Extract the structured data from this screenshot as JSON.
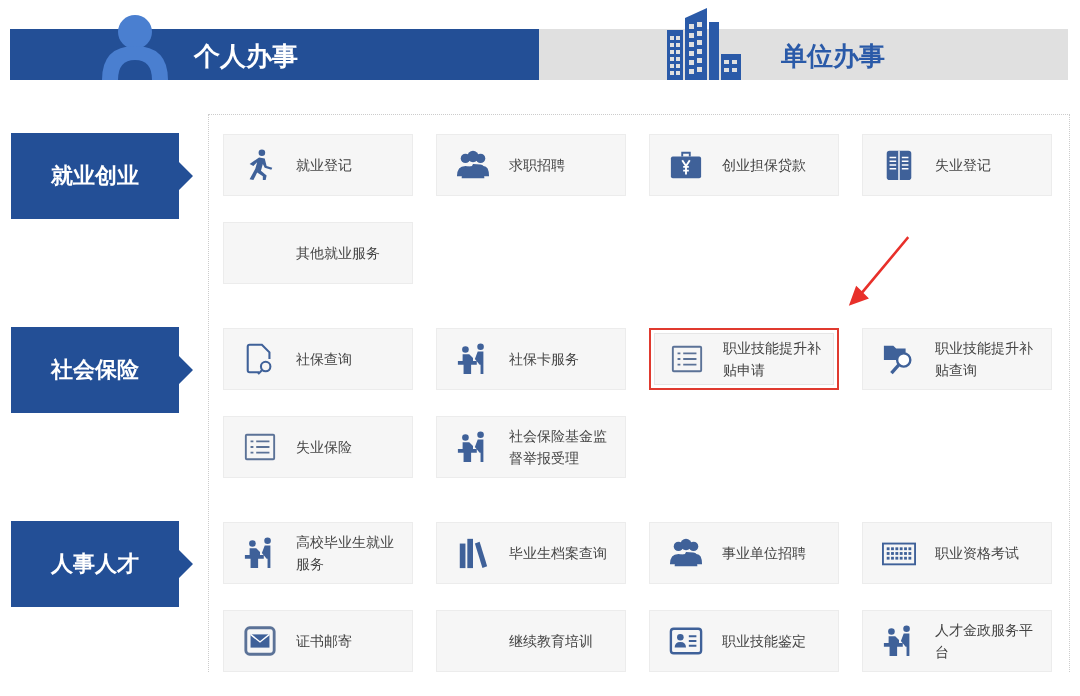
{
  "tabs": [
    {
      "label": "个人办事",
      "selected": true,
      "kind": "person"
    },
    {
      "label": "单位办事",
      "selected": false,
      "kind": "building"
    }
  ],
  "groups": [
    {
      "label": "就业创业",
      "items": [
        {
          "label": "就业登记",
          "kind": "walk",
          "highlighted": false
        },
        {
          "label": "求职招聘",
          "kind": "people",
          "highlighted": false
        },
        {
          "label": "创业担保贷款",
          "kind": "case",
          "highlighted": false
        },
        {
          "label": "失业登记",
          "kind": "book",
          "highlighted": false
        },
        {
          "label": "其他就业服务",
          "kind": "none",
          "highlighted": false
        }
      ]
    },
    {
      "label": "社会保险",
      "items": [
        {
          "label": "社保查询",
          "kind": "docsearch",
          "highlighted": false
        },
        {
          "label": "社保卡服务",
          "kind": "service",
          "highlighted": false
        },
        {
          "label": "职业技能提升补贴申请",
          "kind": "list",
          "highlighted": true
        },
        {
          "label": "职业技能提升补贴查询",
          "kind": "foldersearch",
          "highlighted": false
        },
        {
          "label": "失业保险",
          "kind": "lines",
          "highlighted": false
        },
        {
          "label": "社会保险基金监督举报受理",
          "kind": "service",
          "highlighted": false
        }
      ]
    },
    {
      "label": "人事人才",
      "items": [
        {
          "label": "高校毕业生就业服务",
          "kind": "service",
          "highlighted": false
        },
        {
          "label": "毕业生档案查询",
          "kind": "books",
          "highlighted": false
        },
        {
          "label": "事业单位招聘",
          "kind": "people",
          "highlighted": false
        },
        {
          "label": "职业资格考试",
          "kind": "keyboard",
          "highlighted": false
        },
        {
          "label": "证书邮寄",
          "kind": "mail",
          "highlighted": false
        },
        {
          "label": "继续教育培训",
          "kind": "none",
          "highlighted": false
        },
        {
          "label": "职业技能鉴定",
          "kind": "card",
          "highlighted": false
        },
        {
          "label": "人才金政服务平台",
          "kind": "service",
          "highlighted": false
        }
      ]
    }
  ]
}
